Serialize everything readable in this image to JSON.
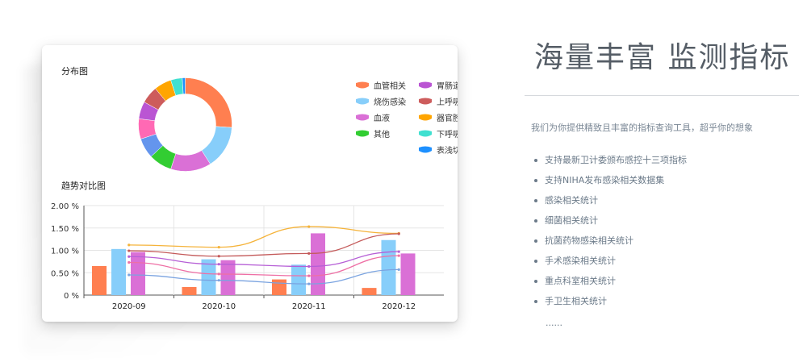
{
  "colors": {
    "red_bar": "#f57c4c",
    "blue_bar": "#87cefa",
    "purple_bar": "#d566d9",
    "line_orange": "#f5b33a",
    "line_red": "#c45a5a",
    "line_purple": "#b65fd6",
    "line_pink": "#ee6fa5",
    "line_blue": "#7aa3e0",
    "text_gray": "#6b7a89"
  },
  "card": {
    "distribution_title": "分布图",
    "trend_title": "趋势对比图"
  },
  "donut": {
    "segments": [
      {
        "label": "血管相关",
        "value": 26,
        "color": "#ff7f50",
        "icon": "pill-icon"
      },
      {
        "label": "烧伤感染",
        "value": 15,
        "color": "#87cefa",
        "icon": "pill-icon"
      },
      {
        "label": "血液",
        "value": 14,
        "color": "#da70d6",
        "icon": "pill-icon"
      },
      {
        "label": "其他",
        "value": 8,
        "color": "#32cd32",
        "icon": "pill-icon"
      },
      {
        "label": "表浅切口",
        "value": 7,
        "color": "#6495ed",
        "icon": "pill-icon"
      },
      {
        "label": "下呼吸道",
        "value": 7,
        "color": "#ff69b4",
        "icon": "pill-icon"
      },
      {
        "label": "器官腔隙",
        "value": 6,
        "color": "#ba55d3",
        "icon": "pill-icon"
      },
      {
        "label": "上呼吸道",
        "value": 6,
        "color": "#cd5c5c",
        "icon": "pill-icon"
      },
      {
        "label": "胃肠道",
        "value": 6,
        "color": "#ffa500",
        "icon": "pill-icon"
      },
      {
        "label": "下呼吸道2",
        "value": 4,
        "color": "#40e0d0",
        "icon": "pill-icon"
      },
      {
        "label": "表浅切口2",
        "value": 1,
        "color": "#1e90ff",
        "icon": "pill-icon"
      }
    ]
  },
  "legend": {
    "left": [
      {
        "label": "血管相关",
        "color": "#ff7f50"
      },
      {
        "label": "烧伤感染",
        "color": "#87cefa"
      },
      {
        "label": "血液",
        "color": "#da70d6"
      },
      {
        "label": "其他",
        "color": "#32cd32"
      }
    ],
    "right": [
      {
        "label": "胃肠道",
        "color": "#ba55d3"
      },
      {
        "label": "上呼吸道",
        "color": "#cd5c5c"
      },
      {
        "label": "器官腔隙",
        "color": "#ffa500"
      },
      {
        "label": "下呼吸道",
        "color": "#40e0d0"
      },
      {
        "label": "表浅切口",
        "color": "#1e90ff"
      }
    ]
  },
  "chart_data": {
    "type": "bar",
    "categories": [
      "2020-09",
      "2020-10",
      "2020-11",
      "2020-12"
    ],
    "ylim": [
      0,
      2.0
    ],
    "yticks": [
      "0 %",
      "0.50 %",
      "1.00 %",
      "1.50 %",
      "2.00 %"
    ],
    "ytick_values": [
      0,
      0.5,
      1.0,
      1.5,
      2.0
    ],
    "series": [
      {
        "values": [
          0.65,
          0.18,
          0.35,
          0.16
        ],
        "color": "#ff7f50",
        "kind": "bar"
      },
      {
        "values": [
          1.03,
          0.8,
          0.68,
          1.23
        ],
        "color": "#87cefa",
        "kind": "bar"
      },
      {
        "values": [
          0.96,
          0.78,
          1.38,
          0.93
        ],
        "color": "#da70d6",
        "kind": "bar"
      },
      {
        "values": [
          1.12,
          1.07,
          1.53,
          1.38
        ],
        "color": "#f5b33a",
        "kind": "line"
      },
      {
        "values": [
          0.99,
          0.87,
          0.93,
          1.37
        ],
        "color": "#c45a5a",
        "kind": "line"
      },
      {
        "values": [
          0.86,
          0.69,
          0.64,
          0.97
        ],
        "color": "#b65fd6",
        "kind": "line"
      },
      {
        "values": [
          0.73,
          0.47,
          0.43,
          0.88
        ],
        "color": "#ee6fa5",
        "kind": "line"
      },
      {
        "values": [
          0.45,
          0.33,
          0.25,
          0.57
        ],
        "color": "#7aa3e0",
        "kind": "line"
      }
    ]
  },
  "right": {
    "headline": "海量丰富 监测指标",
    "subtitle": "我们为你提供精致且丰富的指标查询工具，超乎你的想象",
    "features": [
      "支持最新卫计委颁布感控十三项指标",
      "支持NIHA发布感染相关数据集",
      "感染相关统计",
      "细菌相关统计",
      "抗菌药物感染相关统计",
      "手术感染相关统计",
      "重点科室相关统计",
      "手卫生相关统计"
    ],
    "more": "......"
  }
}
